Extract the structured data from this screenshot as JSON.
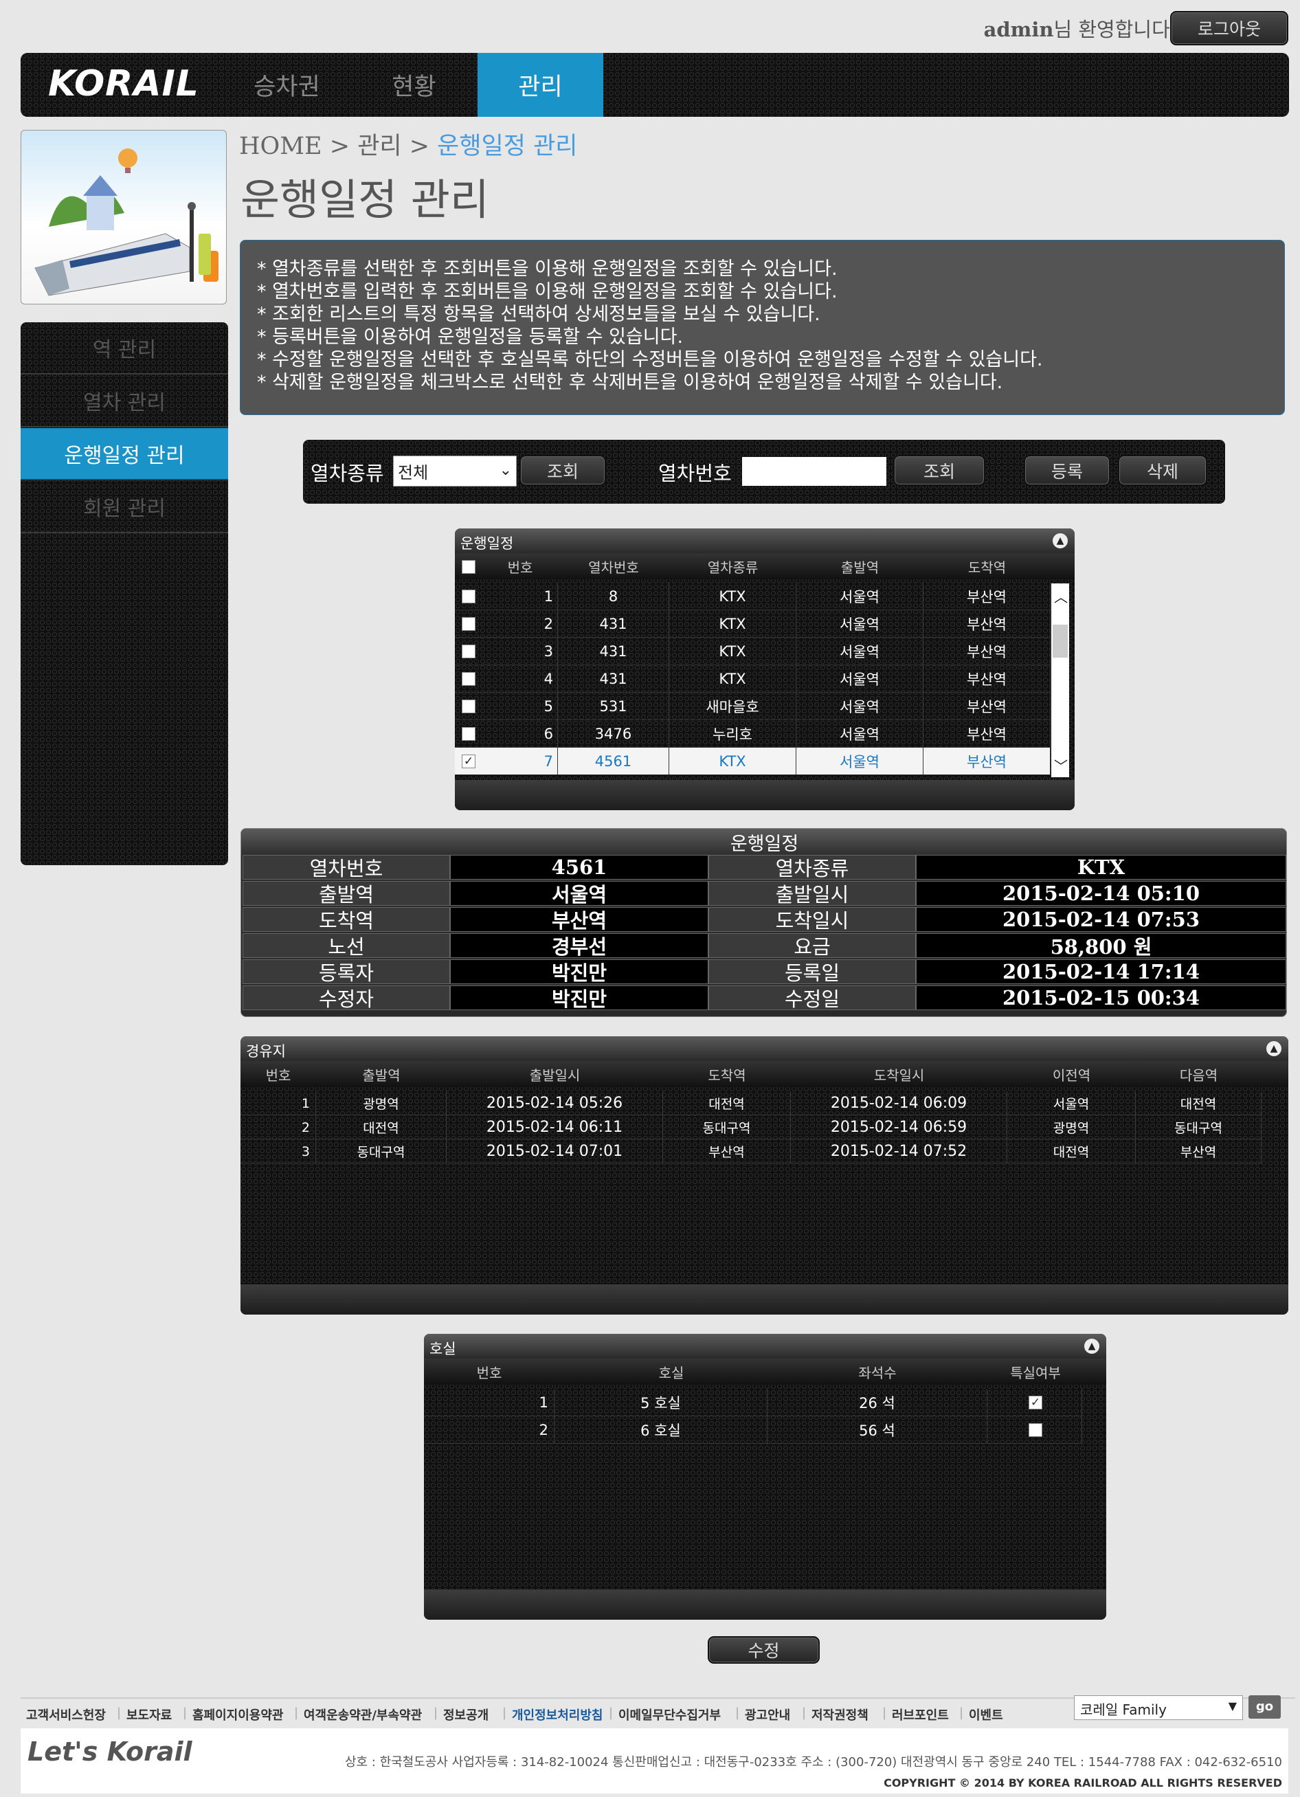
{
  "header": {
    "user": "admin",
    "welcome_suffix": "님 환영합니다.",
    "logout_label": "로그아웃",
    "logo_text": "KORAIL",
    "nav": [
      "승차권",
      "현황",
      "관리"
    ]
  },
  "sidebar": {
    "items": [
      "역 관리",
      "열차 관리",
      "운행일정 관리",
      "회원 관리"
    ]
  },
  "breadcrumb": {
    "home": "HOME",
    "sep1": " > ",
    "parent": "관리",
    "sep2": " > ",
    "current": "운행일정 관리"
  },
  "page_title": "운행일정 관리",
  "info_lines": [
    "* 열차종류를 선택한 후 조회버튼을 이용해 운행일정을 조회할 수 있습니다.",
    "* 열차번호를 입력한 후 조회버튼을 이용해 운행일정을 조회할 수 있습니다.",
    "* 조회한 리스트의 특정 항목을 선택하여 상세정보들을 보실 수 있습니다.",
    "* 등록버튼을 이용하여 운행일정을 등록할 수 있습니다.",
    "* 수정할 운행일정을 선택한 후 호실목록 하단의 수정버튼을 이용하여 운행일정을 수정할 수 있습니다.",
    "* 삭제할 운행일정을 체크박스로 선택한 후 삭제버튼을 이용하여 운행일정을 삭제할 수 있습니다."
  ],
  "search": {
    "type_label": "열차종류",
    "type_value": "전체",
    "query1": "조회",
    "number_label": "열차번호",
    "number_value": "",
    "query2": "조회",
    "register": "등록",
    "delete": "삭제"
  },
  "schedule_grid": {
    "title": "운행일정",
    "columns": [
      "번호",
      "열차번호",
      "열차종류",
      "출발역",
      "도착역"
    ],
    "rows": [
      {
        "no": "1",
        "train": "8",
        "type": "KTX",
        "from": "서울역",
        "to": "부산역",
        "checked": false
      },
      {
        "no": "2",
        "train": "431",
        "type": "KTX",
        "from": "서울역",
        "to": "부산역",
        "checked": false
      },
      {
        "no": "3",
        "train": "431",
        "type": "KTX",
        "from": "서울역",
        "to": "부산역",
        "checked": false
      },
      {
        "no": "4",
        "train": "431",
        "type": "KTX",
        "from": "서울역",
        "to": "부산역",
        "checked": false
      },
      {
        "no": "5",
        "train": "531",
        "type": "새마을호",
        "from": "서울역",
        "to": "부산역",
        "checked": false
      },
      {
        "no": "6",
        "train": "3476",
        "type": "누리호",
        "from": "서울역",
        "to": "부산역",
        "checked": false
      },
      {
        "no": "7",
        "train": "4561",
        "type": "KTX",
        "from": "서울역",
        "to": "부산역",
        "checked": true
      }
    ]
  },
  "detail": {
    "title": "운행일정",
    "rows": [
      [
        "열차번호",
        "4561",
        "열차종류",
        "KTX"
      ],
      [
        "출발역",
        "서울역",
        "출발일시",
        "2015-02-14 05:10"
      ],
      [
        "도착역",
        "부산역",
        "도착일시",
        "2015-02-14 07:53"
      ],
      [
        "노선",
        "경부선",
        "요금",
        "58,800 원"
      ],
      [
        "등록자",
        "박진만",
        "등록일",
        "2015-02-14 17:14"
      ],
      [
        "수정자",
        "박진만",
        "수정일",
        "2015-02-15 00:34"
      ]
    ]
  },
  "stops_grid": {
    "title": "경유지",
    "columns": [
      "번호",
      "출발역",
      "출발일시",
      "도착역",
      "도착일시",
      "이전역",
      "다음역"
    ],
    "rows": [
      [
        "1",
        "광명역",
        "2015-02-14 05:26",
        "대전역",
        "2015-02-14 06:09",
        "서울역",
        "대전역"
      ],
      [
        "2",
        "대전역",
        "2015-02-14 06:11",
        "동대구역",
        "2015-02-14 06:59",
        "광명역",
        "동대구역"
      ],
      [
        "3",
        "동대구역",
        "2015-02-14 07:01",
        "부산역",
        "2015-02-14 07:52",
        "대전역",
        "부산역"
      ]
    ]
  },
  "car_grid": {
    "title": "호실",
    "columns": [
      "번호",
      "호실",
      "좌석수",
      "특실여부"
    ],
    "rows": [
      {
        "no": "1",
        "car": "5 호실",
        "seats": "26 석",
        "special": true
      },
      {
        "no": "2",
        "car": "6 호실",
        "seats": "56 석",
        "special": false
      }
    ]
  },
  "modify_label": "수정",
  "footer": {
    "links": [
      "고객서비스헌장",
      "보도자료",
      "홈페이지이용약관",
      "여객운송약관/부속약관",
      "정보공개",
      "개인정보처리방침",
      "이메일무단수집거부",
      "광고안내",
      "저작권정책",
      "러브포인트",
      "이벤트"
    ],
    "family_label": "코레일 Family",
    "go_label": "go",
    "brand": "Let's Korail",
    "address": "상호 : 한국철도공사    사업자등록 : 314-82-10024    통신판매업신고 : 대전동구-0233호    주소 : (300-720) 대전광역시 동구 중앙로 240    TEL : 1544-7788    FAX : 042-632-6510",
    "copyright": "COPYRIGHT © 2014 BY KOREA RAILROAD  ALL RIGHTS RESERVED"
  },
  "colors": {
    "accent": "#1a93c9",
    "highlight_text": "#1a78c2"
  }
}
